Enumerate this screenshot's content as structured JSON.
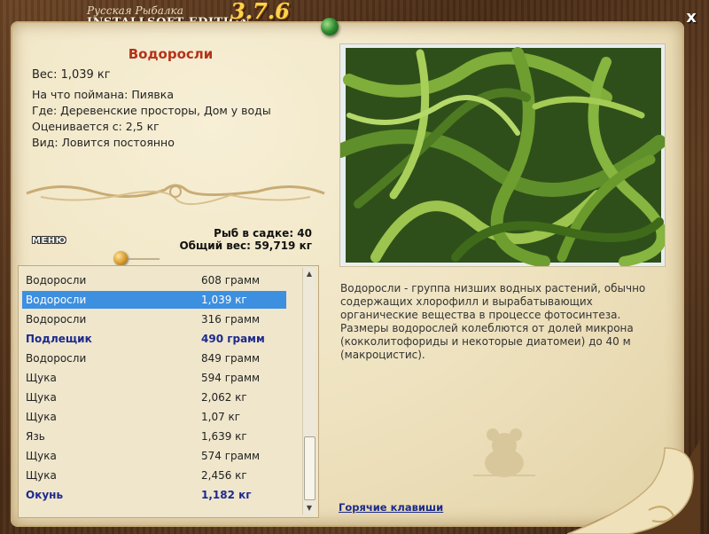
{
  "app": {
    "logo_line1": "Русская Рыбалка",
    "logo_line2": "INSTALLSOFT EDITION",
    "version": "3.7.6",
    "close_label": "x"
  },
  "fish": {
    "name": "Водоросли",
    "weight": "Вес: 1,039 кг",
    "caught_on": "На что поймана: Пиявка",
    "location": "Где: Деревенские просторы, Дом у воды",
    "valued_from": "Оценивается с: 2,5 кг",
    "species": "Вид: Ловится постоянно",
    "description": "Водоросли - группа низших водных растений, обычно содержащих хлорофилл и вырабатывающих органические вещества в процессе фотосинтеза. Размеры водорослей колеблются от долей микрона (кокколитофориды и некоторые диатомеи) до 40 м (макроцистис)."
  },
  "stats": {
    "fish_count": "Рыб в садке: 40",
    "total_weight": "Общий вес: 59,719 кг"
  },
  "menu_label": "МЕНЮ",
  "hotkeys_label": "Горячие клавиши",
  "catch_list": [
    {
      "name": "Водоросли",
      "weight": "608 грамм",
      "state": "normal"
    },
    {
      "name": "Водоросли",
      "weight": "1,039 кг",
      "state": "selected"
    },
    {
      "name": "Водоросли",
      "weight": "316 грамм",
      "state": "normal"
    },
    {
      "name": "Подлещик",
      "weight": "490 грамм",
      "state": "bold"
    },
    {
      "name": "Водоросли",
      "weight": "849 грамм",
      "state": "normal"
    },
    {
      "name": "Щука",
      "weight": "594 грамм",
      "state": "normal"
    },
    {
      "name": "Щука",
      "weight": "2,062 кг",
      "state": "normal"
    },
    {
      "name": "Щука",
      "weight": "1,07 кг",
      "state": "normal"
    },
    {
      "name": "Язь",
      "weight": "1,639 кг",
      "state": "normal"
    },
    {
      "name": "Щука",
      "weight": "574 грамм",
      "state": "normal"
    },
    {
      "name": "Щука",
      "weight": "2,456 кг",
      "state": "normal"
    },
    {
      "name": "Окунь",
      "weight": "1,182 кг",
      "state": "bold"
    }
  ],
  "colors": {
    "title_red": "#b5321a",
    "selection_blue": "#3d8fe0",
    "link_blue": "#1c2b8a",
    "version_gold": "#ffd34a"
  }
}
